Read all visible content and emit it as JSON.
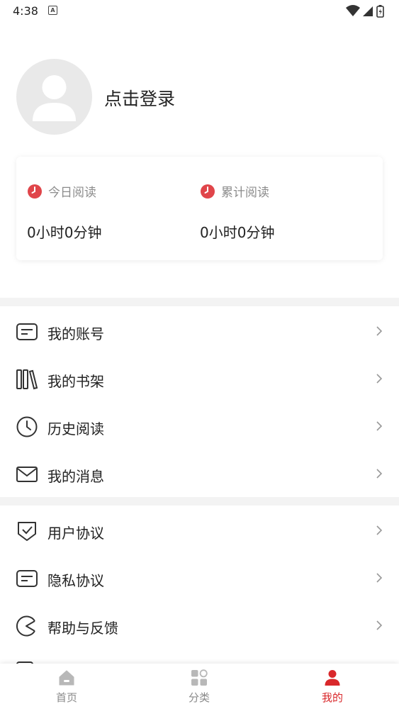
{
  "status_bar": {
    "time": "4:38",
    "notification_glyph": "A"
  },
  "profile": {
    "login_label": "点击登录"
  },
  "stats": {
    "today": {
      "label": "今日阅读",
      "value": "0小时0分钟"
    },
    "total": {
      "label": "累计阅读",
      "value": "0小时0分钟"
    }
  },
  "menu": {
    "group1": [
      {
        "label": "我的账号",
        "icon": "account-card-icon"
      },
      {
        "label": "我的书架",
        "icon": "bookshelf-icon"
      },
      {
        "label": "历史阅读",
        "icon": "clock-icon"
      },
      {
        "label": "我的消息",
        "icon": "mail-icon"
      }
    ],
    "group2": [
      {
        "label": "用户协议",
        "icon": "shield-check-icon"
      },
      {
        "label": "隐私协议",
        "icon": "privacy-card-icon"
      },
      {
        "label": "帮助与反馈",
        "icon": "help-feedback-icon"
      }
    ]
  },
  "bottom_nav": [
    {
      "label": "首页",
      "icon": "home-icon"
    },
    {
      "label": "分类",
      "icon": "category-icon"
    },
    {
      "label": "我的",
      "icon": "profile-icon",
      "active": true
    }
  ],
  "colors": {
    "accent": "#d9282b",
    "stat_clock": "#e0454a",
    "icon_stroke": "#333333",
    "muted": "#8a8a8a"
  }
}
